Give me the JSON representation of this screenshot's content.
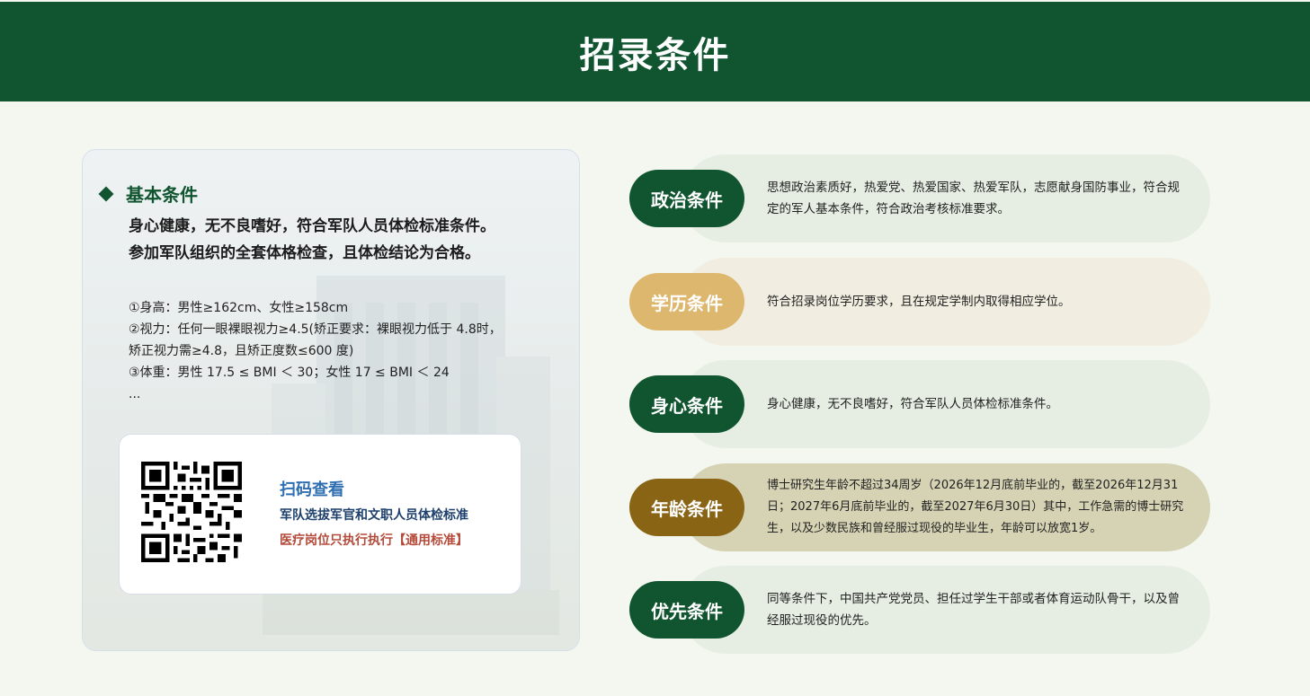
{
  "header": {
    "title": "招录条件"
  },
  "basic": {
    "title": "基本条件",
    "summary_line1": "身心健康，无不良嗜好，符合军队人员体检标准条件。",
    "summary_line2": "参加军队组织的全套体格检查，且体检结论为合格。",
    "details": [
      "①身高：男性≥162cm、女性≥158cm",
      "②视力：任何一眼裸眼视力≥4.5(矫正要求：裸眼视力低于 4.8时，",
      "矫正视力需≥4.8，且矫正度数≤600 度)",
      "③体重：男性 17.5 ≤ BMI ＜ 30；女性 17 ≤ BMI ＜ 24",
      "..."
    ]
  },
  "qr": {
    "title": "扫码查看",
    "line1": "军队选拔军官和文职人员体检标准",
    "line2": "医疗岗位只执行执行【通用标准】"
  },
  "conditions": [
    {
      "label": "政治条件",
      "text": "思想政治素质好，热爱党、热爱国家、热爱军队，志愿献身国防事业，符合规定的军人基本条件，符合政治考核标准要求。",
      "pill_color": "#105530",
      "bg_color": "#e6eee3"
    },
    {
      "label": "学历条件",
      "text": "符合招录岗位学历要求，且在规定学制内取得相应学位。",
      "pill_color": "#ddb76e",
      "bg_color": "#f1ede0"
    },
    {
      "label": "身心条件",
      "text": "身心健康，无不良嗜好，符合军队人员体检标准条件。",
      "pill_color": "#105530",
      "bg_color": "#e6eee3"
    },
    {
      "label": "年龄条件",
      "text": "博士研究生年龄不超过34周岁（2026年12月底前毕业的，截至2026年12月31日；2027年6月底前毕业的，截至2027年6月30日）其中，工作急需的博士研究生，以及少数民族和曾经服过现役的毕业生，年龄可以放宽1岁。",
      "pill_color": "#8a6415",
      "bg_color": "#d6d3b4"
    },
    {
      "label": "优先条件",
      "text": "同等条件下，中国共产党党员、担任过学生干部或者体育运动队骨干，以及曾经服过现役的优先。",
      "pill_color": "#105530",
      "bg_color": "#e6eee3"
    }
  ]
}
